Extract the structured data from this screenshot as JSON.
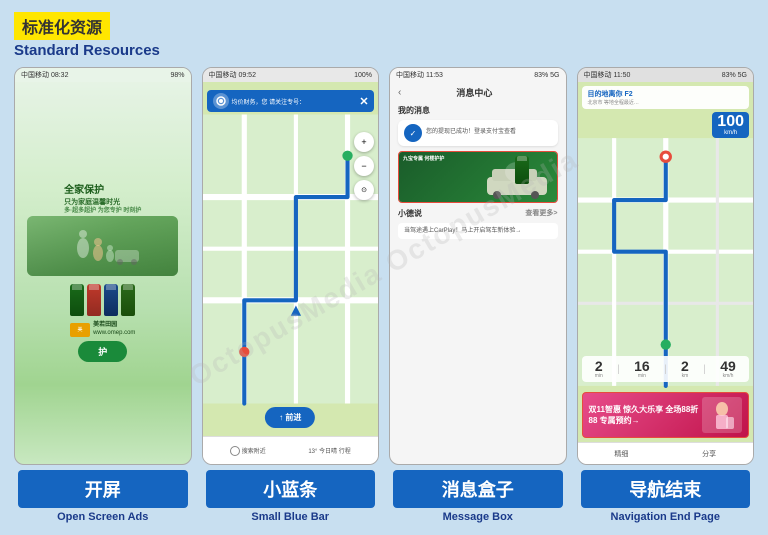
{
  "header": {
    "title_cn": "标准化资源",
    "title_en": "Standard Resources"
  },
  "watermark": "OctopusMedia OctopusMedia",
  "phones": [
    {
      "id": "open-screen",
      "label_cn": "开屏",
      "label_en": "Open Screen Ads",
      "statusbar": "中国移动  08:32",
      "statusbar_right": "98%",
      "cn_text_line1": "全家保护",
      "cn_text_line2": "只为家庭温馨时光",
      "cn_text_line3": "多·超多超护  为您专护  时刻护",
      "brand": "美若田园",
      "brand_url": "www.omep.com"
    },
    {
      "id": "small-blue-bar",
      "label_cn": "小蓝条",
      "label_en": "Small Blue Bar",
      "statusbar": "中国移动  09:52",
      "statusbar_right": "100%",
      "blue_bar_text": "均价财务，您 请关注专号：",
      "bottom_text1": "搜索附近",
      "bottom_text2": "13°  今日晴    行程"
    },
    {
      "id": "message-box",
      "label_cn": "消息盒子",
      "label_en": "Message Box",
      "statusbar": "中国移动  11:53",
      "statusbar_right": "83% 5G",
      "header_title": "消息中心",
      "my_messages": "我的消息",
      "notification_text": "您的提现已成功！登录支付宝查看",
      "ad_text": "九宝专属  何楼护护",
      "section2_title": "小德说",
      "section2_more": "查看更多>",
      "article_text": "当驾途遇上CarPlay！马上开启驾车新体验→"
    },
    {
      "id": "nav-end",
      "label_cn": "导航结束",
      "label_en": "Navigation End Page",
      "statusbar": "中国移动  11:50",
      "statusbar_right": "83% 5G",
      "dest_label": "目的地离你 F2",
      "speed_num": "100",
      "speed_unit": "km/h",
      "time1_num": "2",
      "time1_label": "min",
      "time2_num": "16",
      "time2_label": "min",
      "time3_num": "2",
      "time3_label": "km",
      "time4_num": "49",
      "time4_label": "km/h",
      "ad_text": "双11智惠  惊久大乐享  全场88折88 专属预约→",
      "bottom_left": "精细",
      "bottom_right": "分享"
    }
  ]
}
